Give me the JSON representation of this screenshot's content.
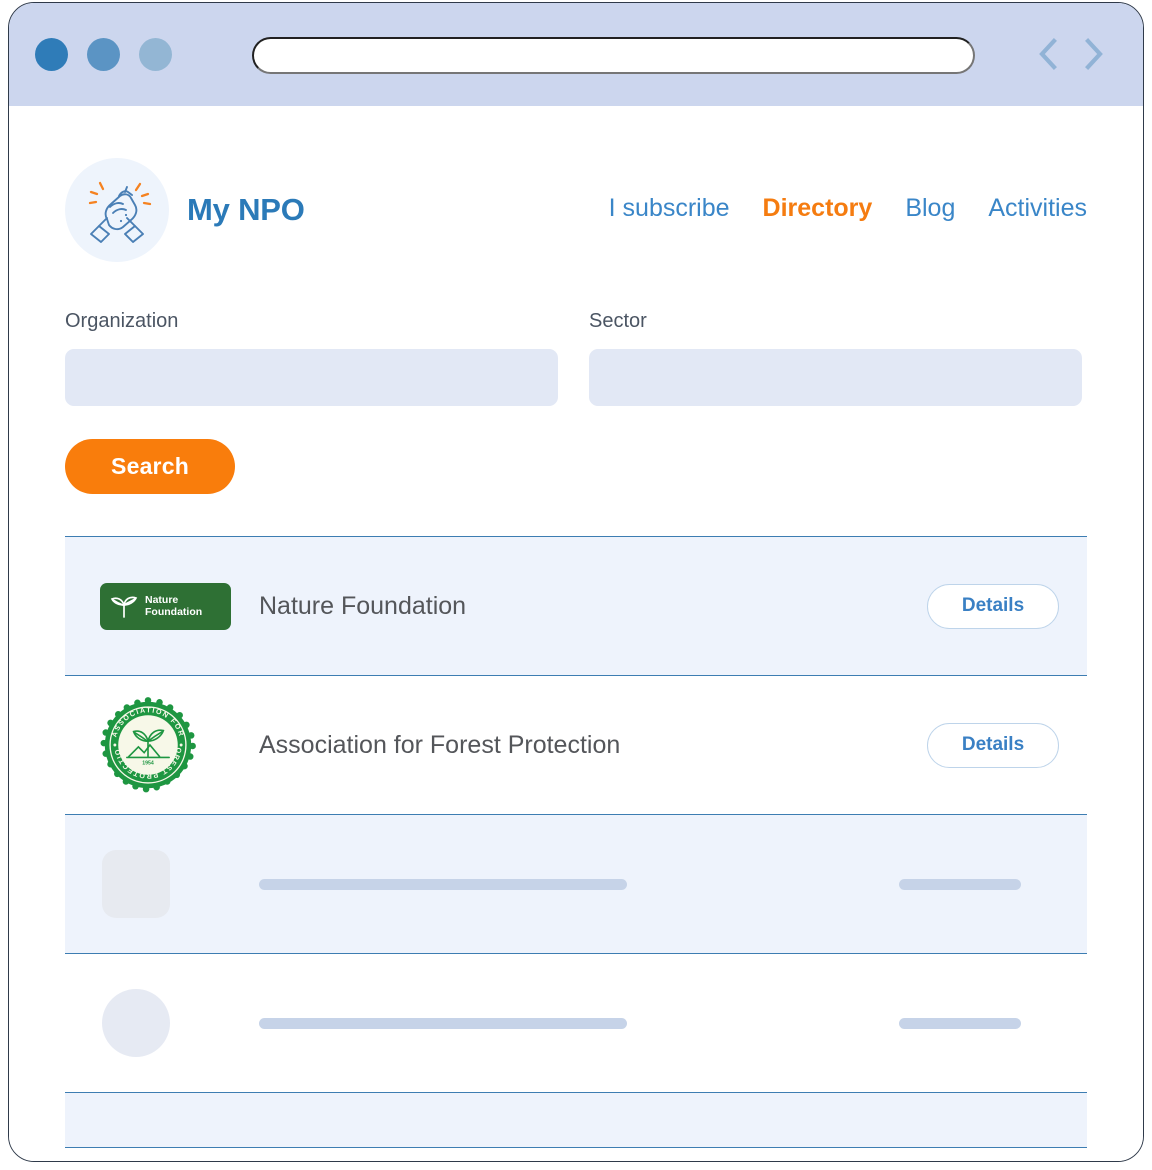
{
  "browser": {
    "traffic_lights": [
      "window-dot-close",
      "window-dot-minimize",
      "window-dot-maximize"
    ],
    "address_bar_value": "",
    "address_bar_placeholder": "",
    "back_icon": "chevron-left-icon",
    "forward_icon": "chevron-right-icon",
    "chrome_color": "#ccd6ee"
  },
  "site": {
    "brand_name": "My NPO",
    "logo_icon": "clasped-hands-icon",
    "brand_color": "#2b7ab8",
    "accent_color": "#f57c10",
    "nav": [
      {
        "label": "I subscribe",
        "active": false
      },
      {
        "label": "Directory",
        "active": true
      },
      {
        "label": "Blog",
        "active": false
      },
      {
        "label": "Activities",
        "active": false
      }
    ]
  },
  "search": {
    "organization_label": "Organization",
    "organization_value": "",
    "organization_placeholder": "",
    "sector_label": "Sector",
    "sector_value": "",
    "sector_placeholder": "",
    "button_label": "Search",
    "button_color": "#f97d0c"
  },
  "results": {
    "details_label": "Details",
    "rows": [
      {
        "name": "Nature Foundation",
        "logo_type": "nature-foundation-badge",
        "logo_icon": "leaf-sprout-icon",
        "logo_text_line1": "Nature",
        "logo_text_line2": "Foundation",
        "logo_color": "#2e7034",
        "has_details": true,
        "background": "tint"
      },
      {
        "name": "Association for Forest Protection",
        "logo_type": "forest-protection-seal",
        "logo_icon": "forest-seal-icon",
        "seal_top_text": "ASSOCIATION FOR",
        "seal_bottom_text": "FOREST PROTECTION",
        "seal_year": "1954",
        "logo_color": "#1e9641",
        "has_details": true,
        "background": "plain"
      },
      {
        "name": "",
        "logo_type": "skeleton-square",
        "has_details": false,
        "background": "tint"
      },
      {
        "name": "",
        "logo_type": "skeleton-circle",
        "has_details": false,
        "background": "plain"
      },
      {
        "name": "",
        "logo_type": "skeleton-partial",
        "has_details": false,
        "background": "tint"
      }
    ]
  }
}
